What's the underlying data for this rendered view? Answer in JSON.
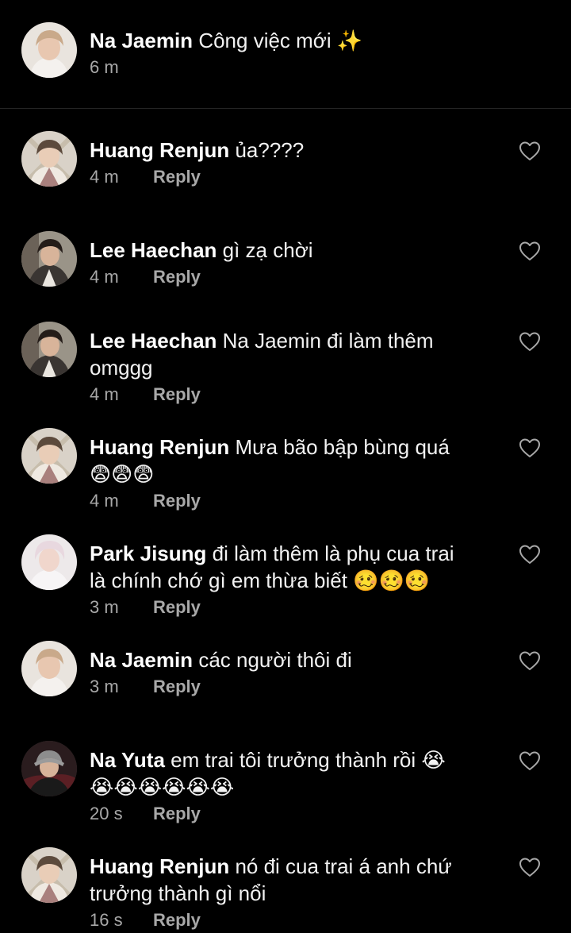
{
  "post": {
    "username": "Na Jaemin",
    "caption": "Công việc mới ✨",
    "time": "6 m"
  },
  "reply_label": "Reply",
  "icons": {
    "like": "heart-outline-icon"
  },
  "colors": {
    "background": "#000000",
    "primary_text": "#f2f2f2",
    "secondary_text": "#a8a8a8",
    "divider": "#262626"
  },
  "comments": [
    {
      "username": "Huang Renjun",
      "lines": [
        "ủa????"
      ],
      "time": "4 m",
      "avatar": "renjun"
    },
    {
      "username": "Lee Haechan",
      "lines": [
        "gì zạ chời"
      ],
      "time": "4 m",
      "avatar": "haechan"
    },
    {
      "username": "Lee Haechan",
      "lines": [
        "Na Jaemin đi làm thêm",
        "omggg"
      ],
      "time": "4 m",
      "avatar": "haechan"
    },
    {
      "username": "Huang Renjun",
      "lines": [
        "Mưa bão bập bùng quá",
        "😨😨😨"
      ],
      "time": "4 m",
      "avatar": "renjun"
    },
    {
      "username": "Park Jisung",
      "lines": [
        "đi làm thêm là phụ cua trai",
        "là chính chớ gì em thừa biết 🥴🥴🥴"
      ],
      "time": "3 m",
      "avatar": "jisung"
    },
    {
      "username": "Na Jaemin",
      "lines": [
        "các người thôi đi"
      ],
      "time": "3 m",
      "avatar": "jaemin"
    },
    {
      "username": "Na Yuta",
      "lines": [
        "em trai tôi trưởng thành rồi 😭",
        "😭😭😭😭😭😭"
      ],
      "time": "20 s",
      "avatar": "yuta"
    },
    {
      "username": "Huang Renjun",
      "lines": [
        "nó đi cua trai á anh chứ",
        "trưởng thành gì nổi"
      ],
      "time": "16 s",
      "avatar": "renjun"
    }
  ]
}
